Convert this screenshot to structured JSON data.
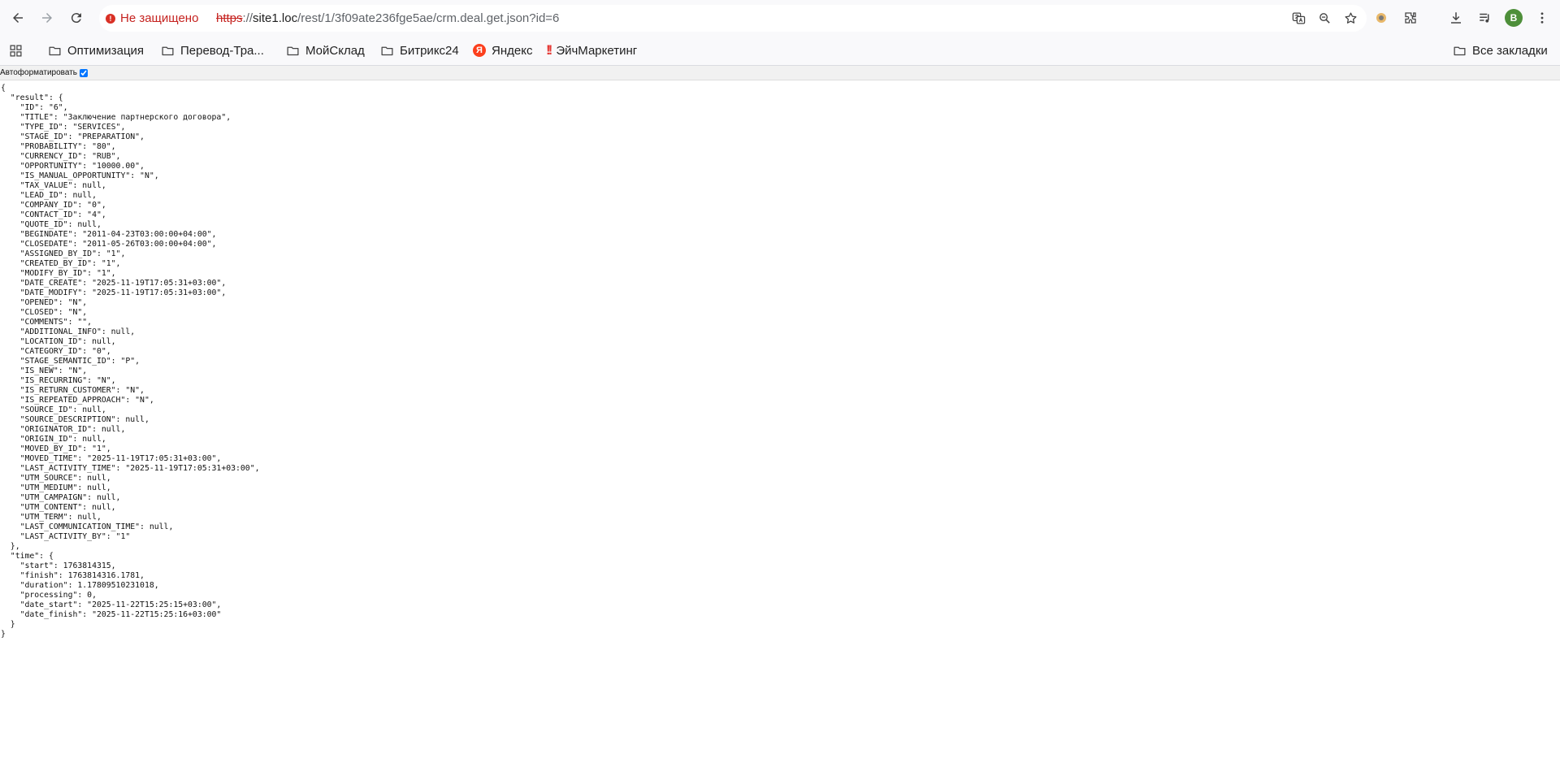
{
  "browser": {
    "security_label": "Не защищено",
    "url": {
      "scheme": "https",
      "separator": "://",
      "host": "site1.loc",
      "path": "/rest/1/3f09ate236fge5ae/crm.deal.get.json?id=6"
    },
    "avatar_letter": "B"
  },
  "bookmarks": {
    "items": [
      {
        "label": "Оптимизация",
        "icon": "folder-icon"
      },
      {
        "label": "Перевод-Тра...",
        "icon": "folder-icon"
      },
      {
        "label": "МойСклад",
        "icon": "folder-icon"
      },
      {
        "label": "Битрикс24",
        "icon": "folder-icon"
      },
      {
        "label": "Яндекс",
        "icon": "yandex-icon"
      },
      {
        "label": "ЭйчМаркетинг",
        "icon": "exclamation-icon"
      }
    ],
    "all_label": "Все закладки"
  },
  "page": {
    "autoformat_label": "Автоформатировать",
    "autoformat_checked": true,
    "json_lines": [
      "{",
      "  \"result\": {",
      "    \"ID\": \"6\",",
      "    \"TITLE\": \"Заключение партнерского договора\",",
      "    \"TYPE_ID\": \"SERVICES\",",
      "    \"STAGE_ID\": \"PREPARATION\",",
      "    \"PROBABILITY\": \"80\",",
      "    \"CURRENCY_ID\": \"RUB\",",
      "    \"OPPORTUNITY\": \"10000.00\",",
      "    \"IS_MANUAL_OPPORTUNITY\": \"N\",",
      "    \"TAX_VALUE\": null,",
      "    \"LEAD_ID\": null,",
      "    \"COMPANY_ID\": \"0\",",
      "    \"CONTACT_ID\": \"4\",",
      "    \"QUOTE_ID\": null,",
      "    \"BEGINDATE\": \"2011-04-23T03:00:00+04:00\",",
      "    \"CLOSEDATE\": \"2011-05-26T03:00:00+04:00\",",
      "    \"ASSIGNED_BY_ID\": \"1\",",
      "    \"CREATED_BY_ID\": \"1\",",
      "    \"MODIFY_BY_ID\": \"1\",",
      "    \"DATE_CREATE\": \"2025-11-19T17:05:31+03:00\",",
      "    \"DATE_MODIFY\": \"2025-11-19T17:05:31+03:00\",",
      "    \"OPENED\": \"N\",",
      "    \"CLOSED\": \"N\",",
      "    \"COMMENTS\": \"\",",
      "    \"ADDITIONAL_INFO\": null,",
      "    \"LOCATION_ID\": null,",
      "    \"CATEGORY_ID\": \"0\",",
      "    \"STAGE_SEMANTIC_ID\": \"P\",",
      "    \"IS_NEW\": \"N\",",
      "    \"IS_RECURRING\": \"N\",",
      "    \"IS_RETURN_CUSTOMER\": \"N\",",
      "    \"IS_REPEATED_APPROACH\": \"N\",",
      "    \"SOURCE_ID\": null,",
      "    \"SOURCE_DESCRIPTION\": null,",
      "    \"ORIGINATOR_ID\": null,",
      "    \"ORIGIN_ID\": null,",
      "    \"MOVED_BY_ID\": \"1\",",
      "    \"MOVED_TIME\": \"2025-11-19T17:05:31+03:00\",",
      "    \"LAST_ACTIVITY_TIME\": \"2025-11-19T17:05:31+03:00\",",
      "    \"UTM_SOURCE\": null,",
      "    \"UTM_MEDIUM\": null,",
      "    \"UTM_CAMPAIGN\": null,",
      "    \"UTM_CONTENT\": null,",
      "    \"UTM_TERM\": null,",
      "    \"LAST_COMMUNICATION_TIME\": null,",
      "    \"LAST_ACTIVITY_BY\": \"1\"",
      "  },",
      "  \"time\": {",
      "    \"start\": 1763814315,",
      "    \"finish\": 1763814316.1781,",
      "    \"duration\": 1.17809510231018,",
      "    \"processing\": 0,",
      "    \"date_start\": \"2025-11-22T15:25:15+03:00\",",
      "    \"date_finish\": \"2025-11-22T15:25:16+03:00\"",
      "  }",
      "}"
    ]
  }
}
